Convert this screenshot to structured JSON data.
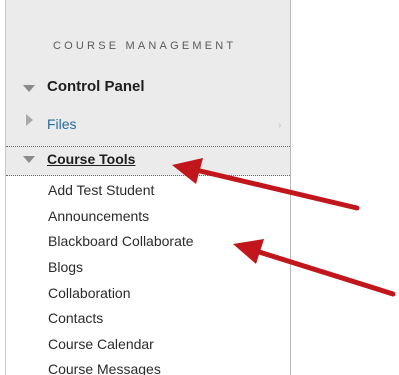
{
  "panel": {
    "heading": "COURSE MANAGEMENT",
    "control_panel_label": "Control Panel",
    "files_label": "Files",
    "files_chevron": "›",
    "course_tools_label": "Course Tools",
    "course_tools_items": [
      "Add Test Student",
      "Announcements",
      "Blackboard Collaborate",
      "Blogs",
      "Collaboration",
      "Contacts",
      "Course Calendar",
      "Course Messages"
    ]
  },
  "icons": {
    "control_panel": "triangle-down-icon",
    "files": "triangle-right-icon",
    "course_tools": "triangle-down-icon"
  },
  "colors": {
    "panel_bg": "#ebebeb",
    "link_blue": "#2a6a9a",
    "arrow_red": "#c0161c"
  }
}
